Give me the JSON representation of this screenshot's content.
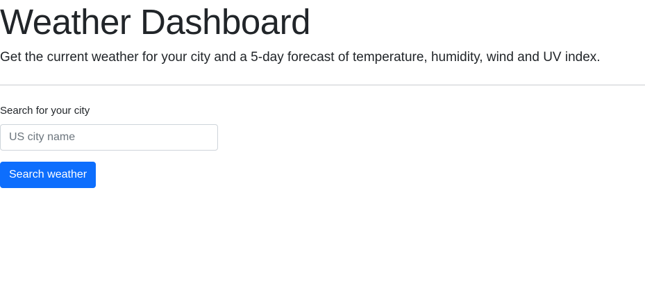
{
  "header": {
    "title": "Weather Dashboard",
    "subtitle": "Get the current weather for your city and a 5-day forecast of temperature, humidity, wind and UV index."
  },
  "search": {
    "label": "Search for your city",
    "placeholder": "US city name",
    "value": "",
    "button_label": "Search weather"
  },
  "colors": {
    "primary": "#0d6efd",
    "text": "#212529",
    "placeholder": "#6c757d",
    "border": "#ced4da",
    "divider": "#c9ccd0",
    "background": "#ffffff"
  }
}
